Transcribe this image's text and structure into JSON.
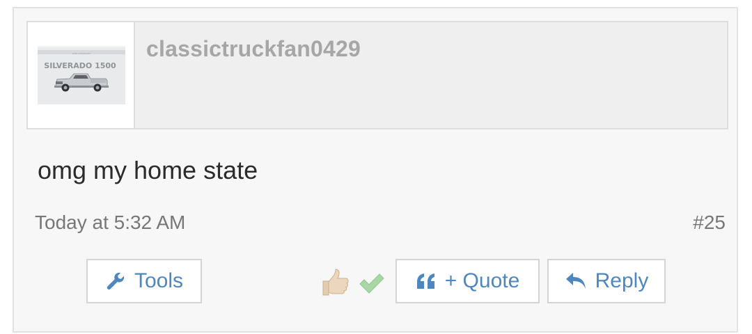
{
  "post": {
    "username": "classictruckfan0429",
    "avatar": {
      "brand_small": "2000 CHEVROLET",
      "model": "SILVERADO 1500"
    },
    "message": "omg my home state",
    "timestamp": "Today at 5:32 AM",
    "post_number": "#25"
  },
  "actions": {
    "tools_label": "Tools",
    "quote_label": "+ Quote",
    "reply_label": "Reply"
  },
  "icons": {
    "tools": "wrench-icon",
    "like": "thumbs-up-icon",
    "check": "checkmark-icon",
    "quote": "quote-marks-icon",
    "reply": "reply-arrow-icon"
  },
  "colors": {
    "link_blue": "#4d87c0",
    "username_gray": "#a6a6a6",
    "check_green": "#8fc98a",
    "thumb_skin": "#ecd6bd"
  }
}
